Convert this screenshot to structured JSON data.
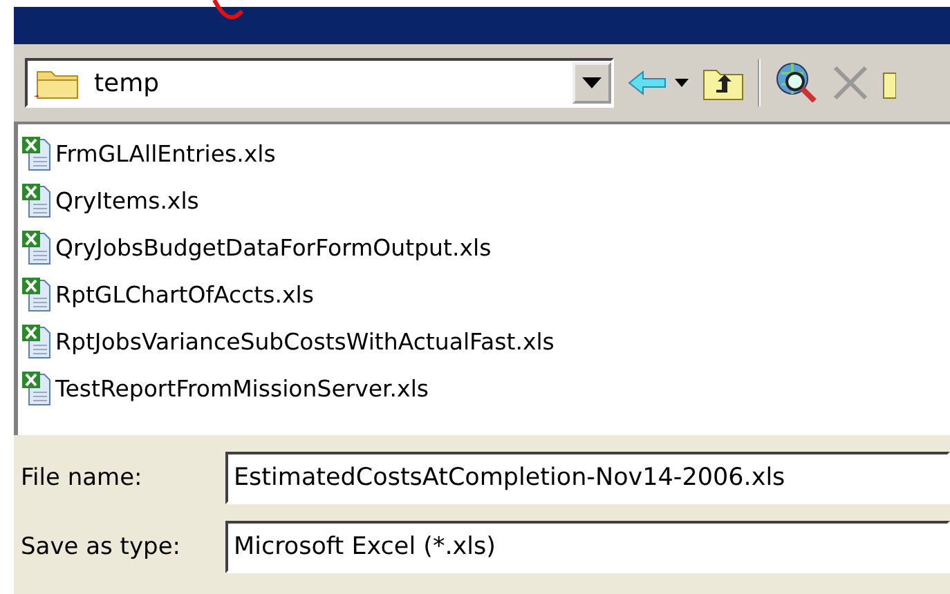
{
  "location": {
    "value": "temp"
  },
  "files": [
    {
      "name": "FrmGLAllEntries.xls"
    },
    {
      "name": "QryItems.xls"
    },
    {
      "name": "QryJobsBudgetDataForFormOutput.xls"
    },
    {
      "name": "RptGLChartOfAccts.xls"
    },
    {
      "name": "RptJobsVarianceSubCostsWithActualFast.xls"
    },
    {
      "name": "TestReportFromMissionServer.xls"
    }
  ],
  "fields": [
    {
      "label": "File name:",
      "value": "EstimatedCostsAtCompletion-Nov14-2006.xls"
    },
    {
      "label": "Save as type:",
      "value": "Microsoft Excel (*.xls)"
    }
  ]
}
